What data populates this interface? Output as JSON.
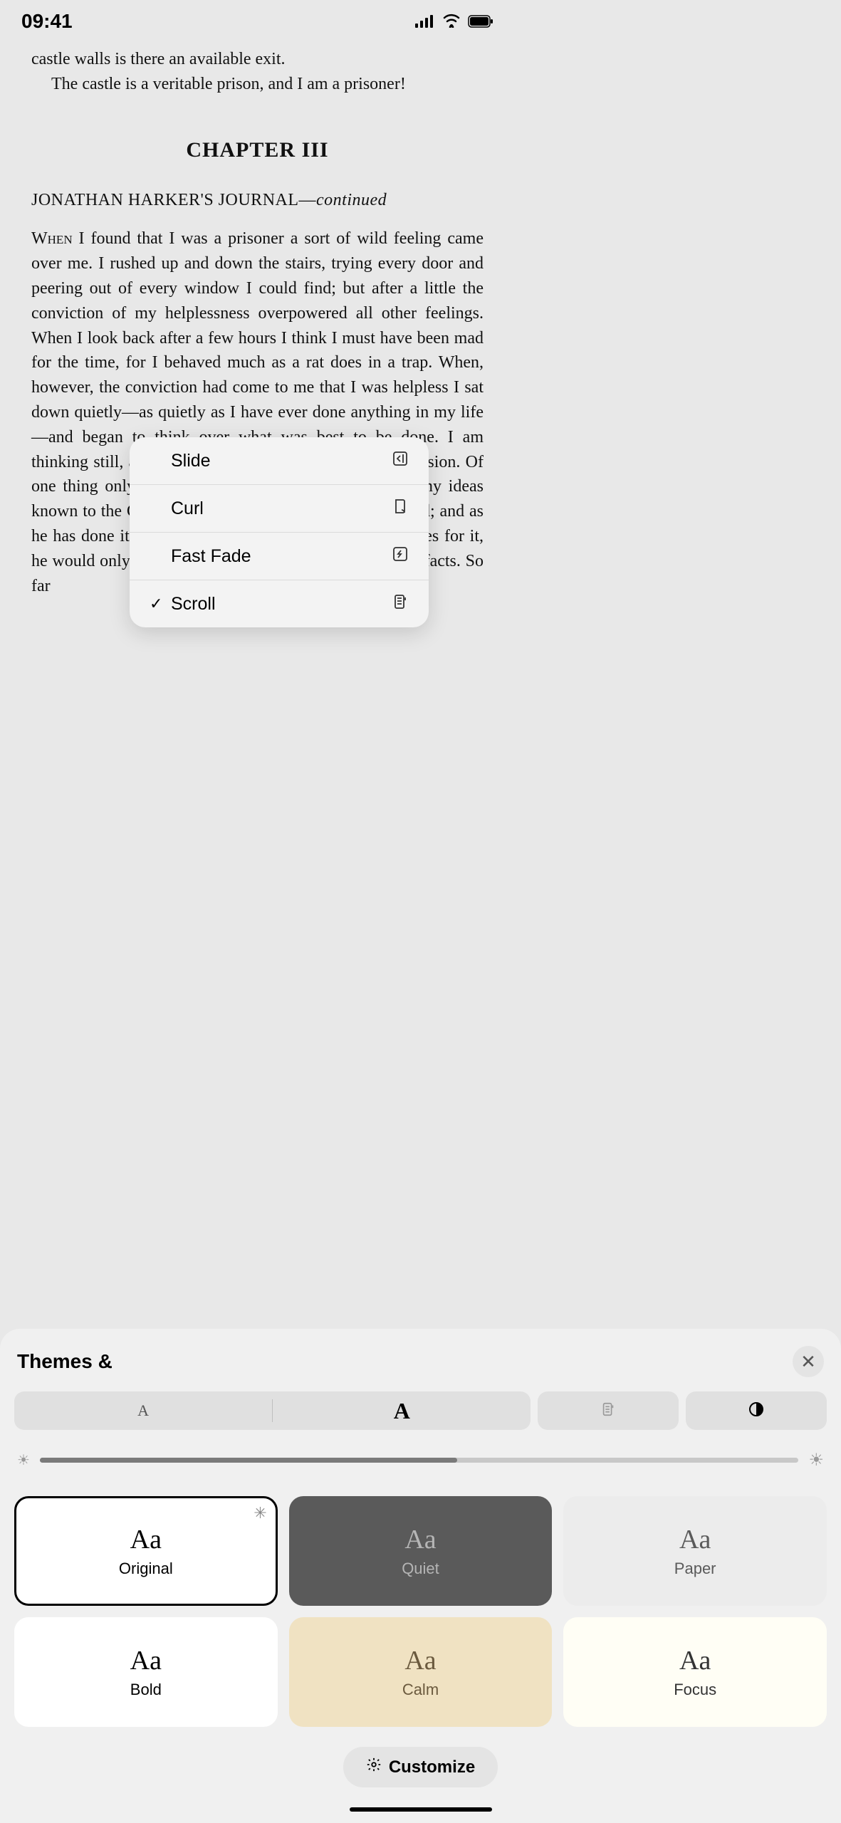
{
  "status": {
    "time": "09:41"
  },
  "book": {
    "line1": "castle walls is there an available exit.",
    "line2": "The castle is a veritable prison, and I am a prisoner!",
    "chapter": "CHAPTER III",
    "journal_prefix": "JONATHAN HARKER'S JOURNAL—",
    "journal_suffix": "continued",
    "body_prefix": "When",
    "body": " I found that I was a prisoner a sort of wild feeling came over me. I rushed up and down the stairs, trying every door and peering out of every window I could find; but after a little the conviction of my helplessness overpowered all other feelings. When I look back after a few hours I think I must have been mad for the time, for I behaved much as a rat does in a trap. When, however, the conviction had come to me that I was helpless I sat down quietly—as quietly as I have ever done anything in my life—and began to think over what was best to be done. I am thinking still, and as yet have come to no definite conclusion. Of one thing only am I certain; that it is no use making my ideas known to the Count. He knows well that I am imprisoned; and as he has done it himself, and has doubtless his own motives for it, he would only deceive me if I trusted him fully with the facts. So far"
  },
  "popup": {
    "items": [
      {
        "label": "Slide",
        "checked": false
      },
      {
        "label": "Curl",
        "checked": false
      },
      {
        "label": "Fast Fade",
        "checked": false
      },
      {
        "label": "Scroll",
        "checked": true
      }
    ]
  },
  "sheet": {
    "title": "Themes &",
    "size_small": "A",
    "size_large": "A",
    "brightness_percent": 55,
    "themes": [
      {
        "name": "Original",
        "bg": "#ffffff",
        "fg": "#000000",
        "selected": true,
        "star": true
      },
      {
        "name": "Quiet",
        "bg": "#5a5a5a",
        "fg": "#b5b5b5",
        "selected": false
      },
      {
        "name": "Paper",
        "bg": "#ececec",
        "fg": "#5a5a5a",
        "selected": false
      },
      {
        "name": "Bold",
        "bg": "#ffffff",
        "fg": "#000000",
        "selected": false
      },
      {
        "name": "Calm",
        "bg": "#f0e2c2",
        "fg": "#6b5a3e",
        "selected": false
      },
      {
        "name": "Focus",
        "bg": "#fffef5",
        "fg": "#333333",
        "selected": false
      }
    ],
    "customize": "Customize"
  }
}
